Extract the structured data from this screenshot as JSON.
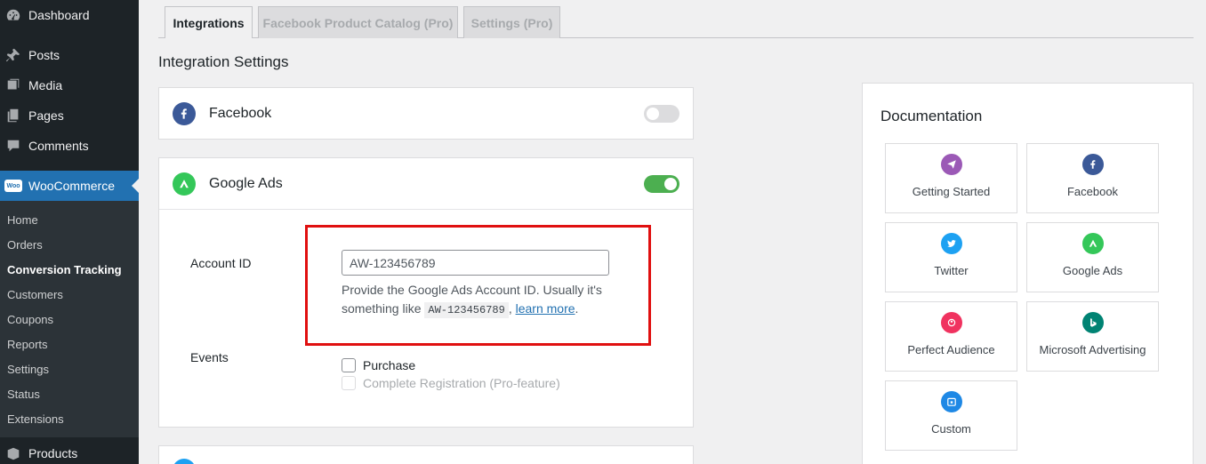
{
  "sidebar": {
    "top_items": [
      {
        "label": "Dashboard",
        "icon": "dashboard-icon"
      },
      {
        "label": "Posts",
        "icon": "pin-icon"
      },
      {
        "label": "Media",
        "icon": "media-icon"
      },
      {
        "label": "Pages",
        "icon": "pages-icon"
      },
      {
        "label": "Comments",
        "icon": "comment-icon"
      },
      {
        "label": "WooCommerce",
        "icon": "woo-icon"
      },
      {
        "label": "Products",
        "icon": "products-icon"
      }
    ],
    "woo_badge": "Woo",
    "submenu": [
      "Home",
      "Orders",
      "Conversion Tracking",
      "Customers",
      "Coupons",
      "Reports",
      "Settings",
      "Status",
      "Extensions"
    ],
    "current_submenu": "Conversion Tracking"
  },
  "tabs": [
    "Integrations",
    "Facebook Product Catalog (Pro)",
    "Settings (Pro)"
  ],
  "main": {
    "title": "Integration Settings",
    "facebook": {
      "title": "Facebook",
      "enabled": false
    },
    "google_ads": {
      "title": "Google Ads",
      "enabled": true,
      "account_label": "Account ID",
      "account_value": "AW-123456789",
      "help_text": "Provide the Google Ads Account ID. Usually it's something like",
      "help_code": "AW-123456789",
      "help_sep": ",",
      "help_link": "learn more",
      "help_end": ".",
      "events_label": "Events",
      "events": [
        {
          "label": "Purchase",
          "checked": false,
          "disabled": false
        },
        {
          "label": "Complete Registration (Pro-feature)",
          "checked": false,
          "disabled": true
        }
      ]
    }
  },
  "documentation": {
    "title": "Documentation",
    "cards": [
      {
        "label": "Getting Started",
        "icon": "paper-plane-icon",
        "color": "#9b59b6"
      },
      {
        "label": "Facebook",
        "icon": "facebook-icon",
        "color": "#3b5998"
      },
      {
        "label": "Twitter",
        "icon": "twitter-icon",
        "color": "#1da1f2"
      },
      {
        "label": "Google Ads",
        "icon": "google-ads-icon",
        "color": "#34c759"
      },
      {
        "label": "Perfect Audience",
        "icon": "perfect-audience-icon",
        "color": "#f0325f"
      },
      {
        "label": "Microsoft Advertising",
        "icon": "bing-icon",
        "color": "#008373"
      },
      {
        "label": "Custom",
        "icon": "calendar-icon",
        "color": "#1e88e5"
      }
    ]
  },
  "colors": {
    "accent": "#2271b1",
    "toggle_on": "#4caf50",
    "highlight": "#e01010"
  }
}
